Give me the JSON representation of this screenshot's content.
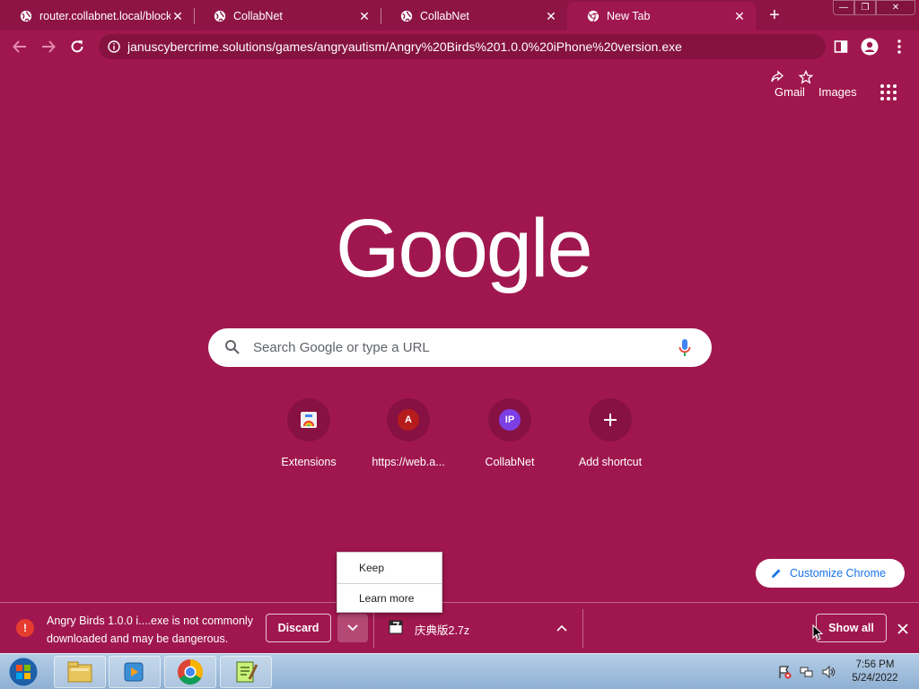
{
  "browser": {
    "tabs": [
      {
        "title": "router.collabnet.local/block",
        "icon": "globe-icon",
        "active": false
      },
      {
        "title": "CollabNet",
        "icon": "globe-icon",
        "active": false
      },
      {
        "title": "CollabNet",
        "icon": "globe-icon",
        "active": false
      },
      {
        "title": "New Tab",
        "icon": "chrome-icon",
        "active": true
      }
    ],
    "new_tab_symbol": "+",
    "close_symbol": "✕",
    "window_controls": {
      "minimize": "—",
      "maximize": "❐",
      "close": "✕"
    }
  },
  "toolbar": {
    "url": "januscybercrime.solutions/games/angryautism/Angry%20Birds%201.0.0%20iPhone%20version.exe"
  },
  "ntp": {
    "links": {
      "gmail": "Gmail",
      "images": "Images"
    },
    "logo": "Google",
    "search_placeholder": "Search Google or type a URL",
    "shortcuts": [
      {
        "label": "Extensions",
        "icon": "extensions-icon"
      },
      {
        "label": "https://web.a...",
        "letter": "A",
        "color": "#b71c1c"
      },
      {
        "label": "CollabNet",
        "letter": "IP",
        "color": "#7b3fe4"
      },
      {
        "label": "Add shortcut",
        "icon": "plus-icon"
      }
    ],
    "customize_label": "Customize Chrome"
  },
  "context_menu": {
    "items": [
      "Keep",
      "Learn more"
    ]
  },
  "download_shelf": {
    "warning_text": "Angry Birds 1.0.0 i....exe is not commonly downloaded and may be dangerous.",
    "discard_label": "Discard",
    "file_name": "庆典版2.7z",
    "show_all_label": "Show all"
  },
  "taskbar": {
    "time": "7:56 PM",
    "date": "5/24/2022"
  },
  "colors": {
    "theme": "#a0174f",
    "tabstrip": "#8e1446",
    "accent_link": "#1a73e8"
  }
}
